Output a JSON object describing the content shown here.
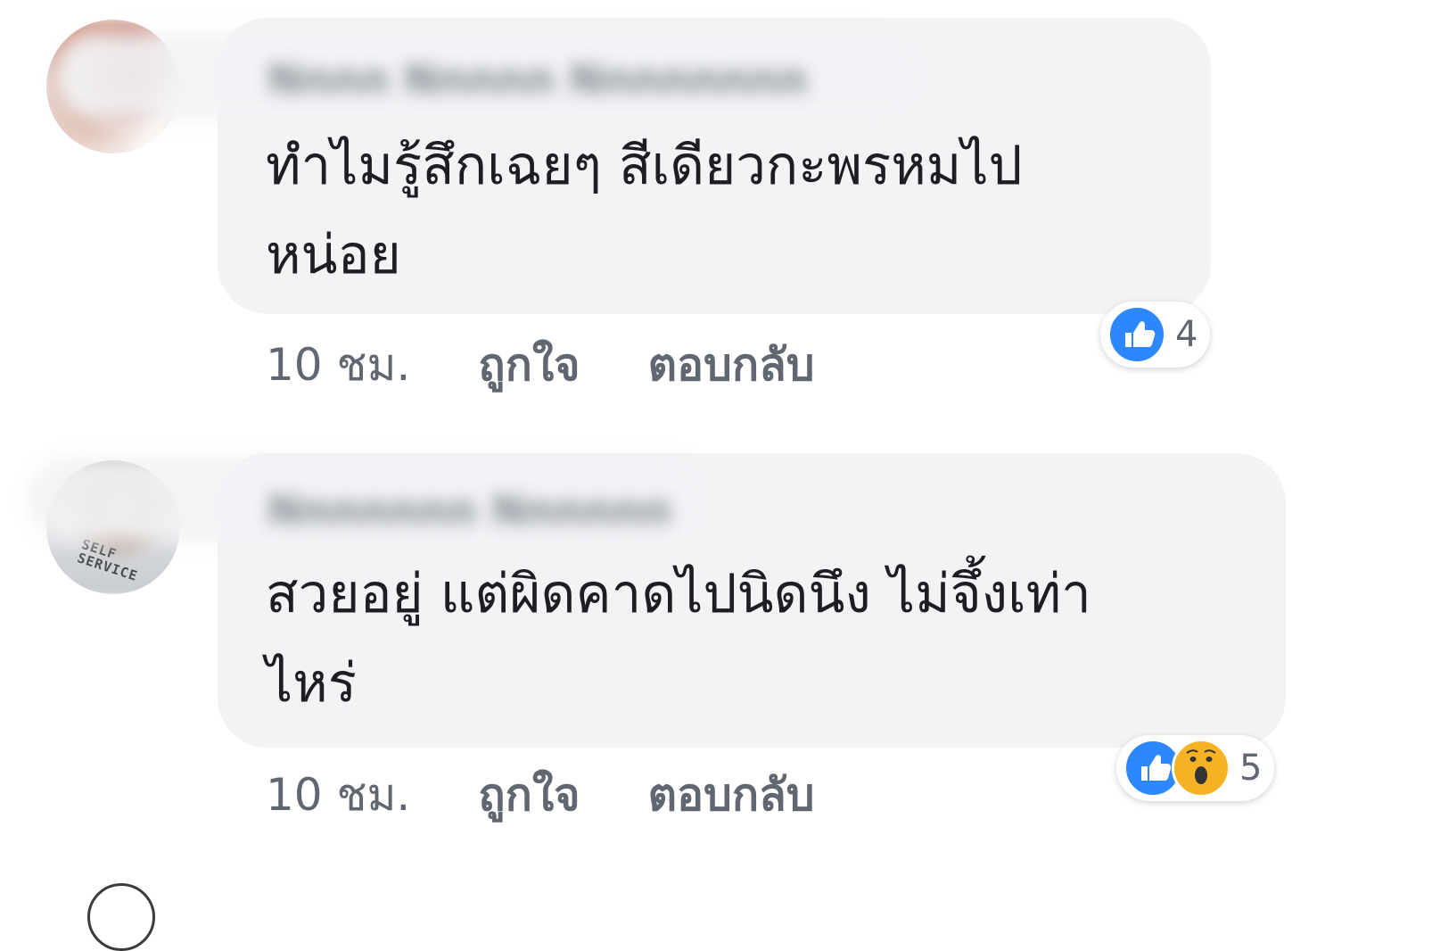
{
  "comments": [
    {
      "author_name": "Nnnn Nnnnn Nnnnnnnn",
      "text": "ทำไมรู้สึกเฉยๆ สีเดียวกะพรหมไป\nหน่อย",
      "timestamp": "10 ชม.",
      "like_label": "ถูกใจ",
      "reply_label": "ตอบกลับ",
      "reactions": [
        "like-icon"
      ],
      "reaction_count": "4"
    },
    {
      "author_name": "Nnnnnnn Nnnnnn",
      "avatar_shirt_text": "SELF\nSERVICE",
      "text": "สวยอยู่ แต่ผิดคาดไปนิดนึง ไม่จึ้งเท่า\nไหร่",
      "timestamp": "10 ชม.",
      "like_label": "ถูกใจ",
      "reply_label": "ตอบกลับ",
      "reactions": [
        "like-icon",
        "wow-icon"
      ],
      "reaction_count": "5"
    }
  ],
  "colors": {
    "bubble": "#f2f3f5",
    "like_blue": "#2d88ff",
    "wow_yellow": "#f7b125",
    "meta_text": "#606770",
    "body_text": "#1c1e21"
  }
}
